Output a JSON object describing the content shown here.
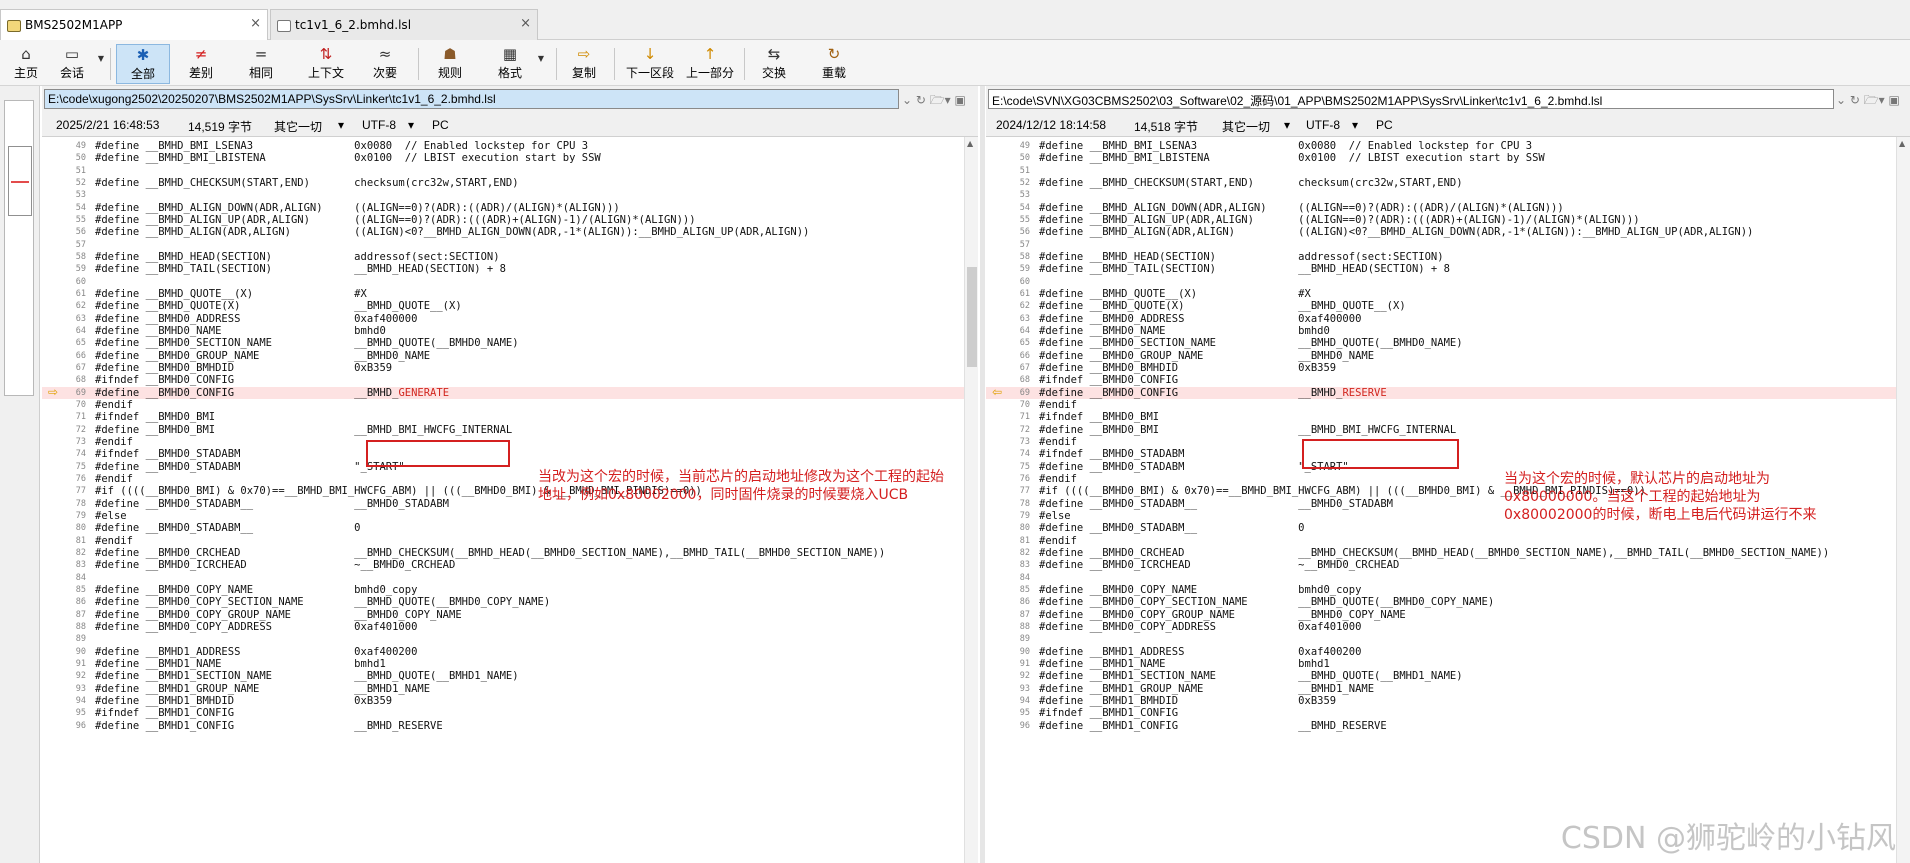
{
  "tabs": [
    {
      "label": "BMS2502M1APP",
      "close": "×"
    },
    {
      "label": "tc1v1_6_2.bmhd.lsl",
      "close": "×"
    }
  ],
  "toolbar": [
    {
      "label": "主页",
      "icon": "⌂"
    },
    {
      "label": "会话",
      "icon": "▭"
    },
    {
      "label": "全部",
      "icon": "✱"
    },
    {
      "label": "差别",
      "icon": "≠"
    },
    {
      "label": "相同",
      "icon": "="
    },
    {
      "label": "上下文",
      "icon": "⇅"
    },
    {
      "label": "次要",
      "icon": "≈"
    },
    {
      "label": "规则",
      "icon": "☗"
    },
    {
      "label": "格式",
      "icon": "▦"
    },
    {
      "label": "复制",
      "icon": "⇨"
    },
    {
      "label": "下一区段",
      "icon": "↓"
    },
    {
      "label": "上一部分",
      "icon": "↑"
    },
    {
      "label": "交换",
      "icon": "⇆"
    },
    {
      "label": "重载",
      "icon": "↻"
    }
  ],
  "left": {
    "path": "E:\\code\\xugong2502\\20250207\\BMS2502M1APP\\SysSrv\\Linker\\tc1v1_6_2.bmhd.lsl",
    "date": "2025/2/21 16:48:53",
    "size": "14,519 字节",
    "other": "其它一切",
    "encoding": "UTF-8",
    "eol": "PC",
    "lines": [
      [
        "49",
        "#define __BMHD_BMI_LSENA3                0x0080  // Enabled lockstep for CPU 3"
      ],
      [
        "50",
        "#define __BMHD_BMI_LBISTENA              0x0100  // LBIST execution start by SSW"
      ],
      [
        "51",
        ""
      ],
      [
        "52",
        "#define __BMHD_CHECKSUM(START,END)       checksum(crc32w,START,END)"
      ],
      [
        "53",
        ""
      ],
      [
        "54",
        "#define __BMHD_ALIGN_DOWN(ADR,ALIGN)     ((ALIGN==0)?(ADR):((ADR)/(ALIGN)*(ALIGN)))"
      ],
      [
        "55",
        "#define __BMHD_ALIGN_UP(ADR,ALIGN)       ((ALIGN==0)?(ADR):(((ADR)+(ALIGN)-1)/(ALIGN)*(ALIGN)))"
      ],
      [
        "56",
        "#define __BMHD_ALIGN(ADR,ALIGN)          ((ALIGN)<0?__BMHD_ALIGN_DOWN(ADR,-1*(ALIGN)):__BMHD_ALIGN_UP(ADR,ALIGN))"
      ],
      [
        "57",
        ""
      ],
      [
        "58",
        "#define __BMHD_HEAD(SECTION)             addressof(sect:SECTION)"
      ],
      [
        "59",
        "#define __BMHD_TAIL(SECTION)             __BMHD_HEAD(SECTION) + 8"
      ],
      [
        "60",
        ""
      ],
      [
        "61",
        "#define __BMHD_QUOTE__(X)                #X"
      ],
      [
        "62",
        "#define __BMHD_QUOTE(X)                  __BMHD_QUOTE__(X)"
      ],
      [
        "63",
        "#define __BMHD0_ADDRESS                  0xaf400000"
      ],
      [
        "64",
        "#define __BMHD0_NAME                     bmhd0"
      ],
      [
        "65",
        "#define __BMHD0_SECTION_NAME             __BMHD_QUOTE(__BMHD0_NAME)"
      ],
      [
        "66",
        "#define __BMHD0_GROUP_NAME               __BMHD0_NAME"
      ],
      [
        "67",
        "#define __BMHD0_BMHDID                   0xB359"
      ],
      [
        "68",
        "#ifndef __BMHD0_CONFIG"
      ],
      [
        "69",
        "#define __BMHD0_CONFIG                   __BMHD_GENERATE"
      ],
      [
        "70",
        "#endif"
      ],
      [
        "71",
        "#ifndef __BMHD0_BMI"
      ],
      [
        "72",
        "#define __BMHD0_BMI                      __BMHD_BMI_HWCFG_INTERNAL"
      ],
      [
        "73",
        "#endif"
      ],
      [
        "74",
        "#ifndef __BMHD0_STADABM"
      ],
      [
        "75",
        "#define __BMHD0_STADABM                  \"_START\""
      ],
      [
        "76",
        "#endif"
      ],
      [
        "77",
        "#if ((((__BMHD0_BMI) & 0x70)==__BMHD_BMI_HWCFG_ABM) || (((__BMHD0_BMI) & __BMHD_BMI_PINDIS)==0))"
      ],
      [
        "78",
        "#define __BMHD0_STADABM__                __BMHD0_STADABM"
      ],
      [
        "79",
        "#else"
      ],
      [
        "80",
        "#define __BMHD0_STADABM__                0"
      ],
      [
        "81",
        "#endif"
      ],
      [
        "82",
        "#define __BMHD0_CRCHEAD                  __BMHD_CHECKSUM(__BMHD_HEAD(__BMHD0_SECTION_NAME),__BMHD_TAIL(__BMHD0_SECTION_NAME))"
      ],
      [
        "83",
        "#define __BMHD0_ICRCHEAD                 ~__BMHD0_CRCHEAD"
      ],
      [
        "84",
        ""
      ],
      [
        "85",
        "#define __BMHD0_COPY_NAME                bmhd0_copy"
      ],
      [
        "86",
        "#define __BMHD0_COPY_SECTION_NAME        __BMHD_QUOTE(__BMHD0_COPY_NAME)"
      ],
      [
        "87",
        "#define __BMHD0_COPY_GROUP_NAME          __BMHD0_COPY_NAME"
      ],
      [
        "88",
        "#define __BMHD0_COPY_ADDRESS             0xaf401000"
      ],
      [
        "89",
        ""
      ],
      [
        "90",
        "#define __BMHD1_ADDRESS                  0xaf400200"
      ],
      [
        "91",
        "#define __BMHD1_NAME                     bmhd1"
      ],
      [
        "92",
        "#define __BMHD1_SECTION_NAME             __BMHD_QUOTE(__BMHD1_NAME)"
      ],
      [
        "93",
        "#define __BMHD1_GROUP_NAME               __BMHD1_NAME"
      ],
      [
        "94",
        "#define __BMHD1_BMHDID                   0xB359"
      ],
      [
        "95",
        "#ifndef __BMHD1_CONFIG"
      ],
      [
        "96",
        "#define __BMHD1_CONFIG                   __BMHD_RESERVE"
      ]
    ],
    "note": "当改为这个宏的时候，当前芯片的启动地址修改为这个工程的起始地址，例如0x80002000，同时固件烧录的时候要烧入UCB"
  },
  "right": {
    "path": "E:\\code\\SVN\\XG03CBMS2502\\03_Software\\02_源码\\01_APP\\BMS2502M1APP\\SysSrv\\Linker\\tc1v1_6_2.bmhd.lsl",
    "date": "2024/12/12 18:14:58",
    "size": "14,518 字节",
    "other": "其它一切",
    "encoding": "UTF-8",
    "eol": "PC",
    "line69": "#define __BMHD0_CONFIG                   __BMHD_RESERVE",
    "note": "当为这个宏的时候，默认芯片的启动地址为0x80000000。当这个工程的起始地址为0x80002000的时候，断电上电后代码讲运行不来"
  },
  "watermark": "CSDN @狮驼岭的小钻风"
}
